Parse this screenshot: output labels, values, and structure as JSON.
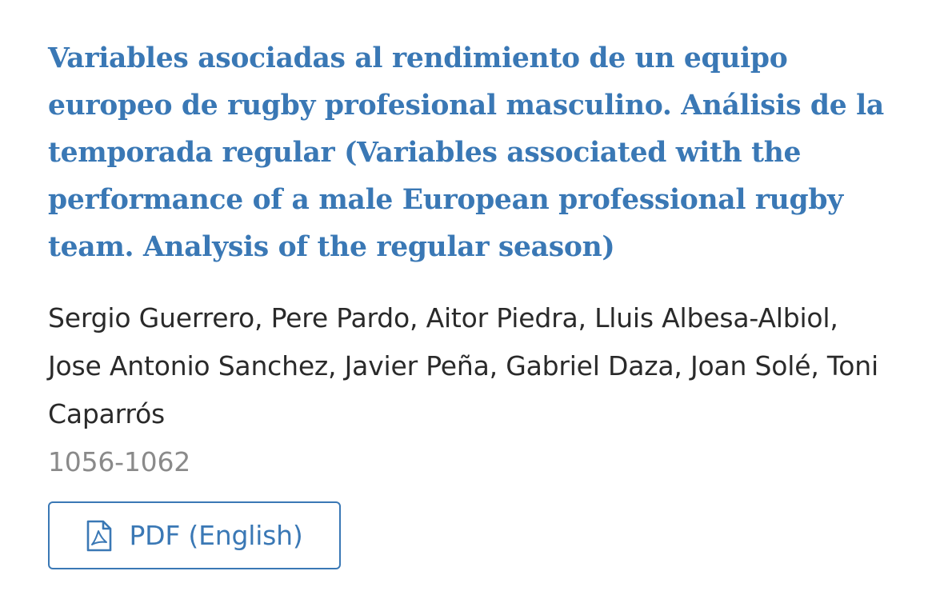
{
  "article": {
    "title": "Variables asociadas al rendimiento de un equipo europeo de rugby profesional masculino. Análisis de la temporada regular (Variables associated with the performance of a male European professional rugby team. Analysis of the regular season)",
    "authors": "Sergio Guerrero, Pere Pardo, Aitor Piedra, Lluis Albesa-Albiol, Jose Antonio Sanchez, Javier Peña, Gabriel Daza, Joan Solé, Toni Caparrós",
    "pages": "1056-1062"
  },
  "galley": {
    "label": "PDF (English)",
    "icon": "file-pdf-icon"
  },
  "colors": {
    "link": "#3a78b5",
    "text": "#2a2a2a",
    "muted": "#8a8a8a"
  }
}
